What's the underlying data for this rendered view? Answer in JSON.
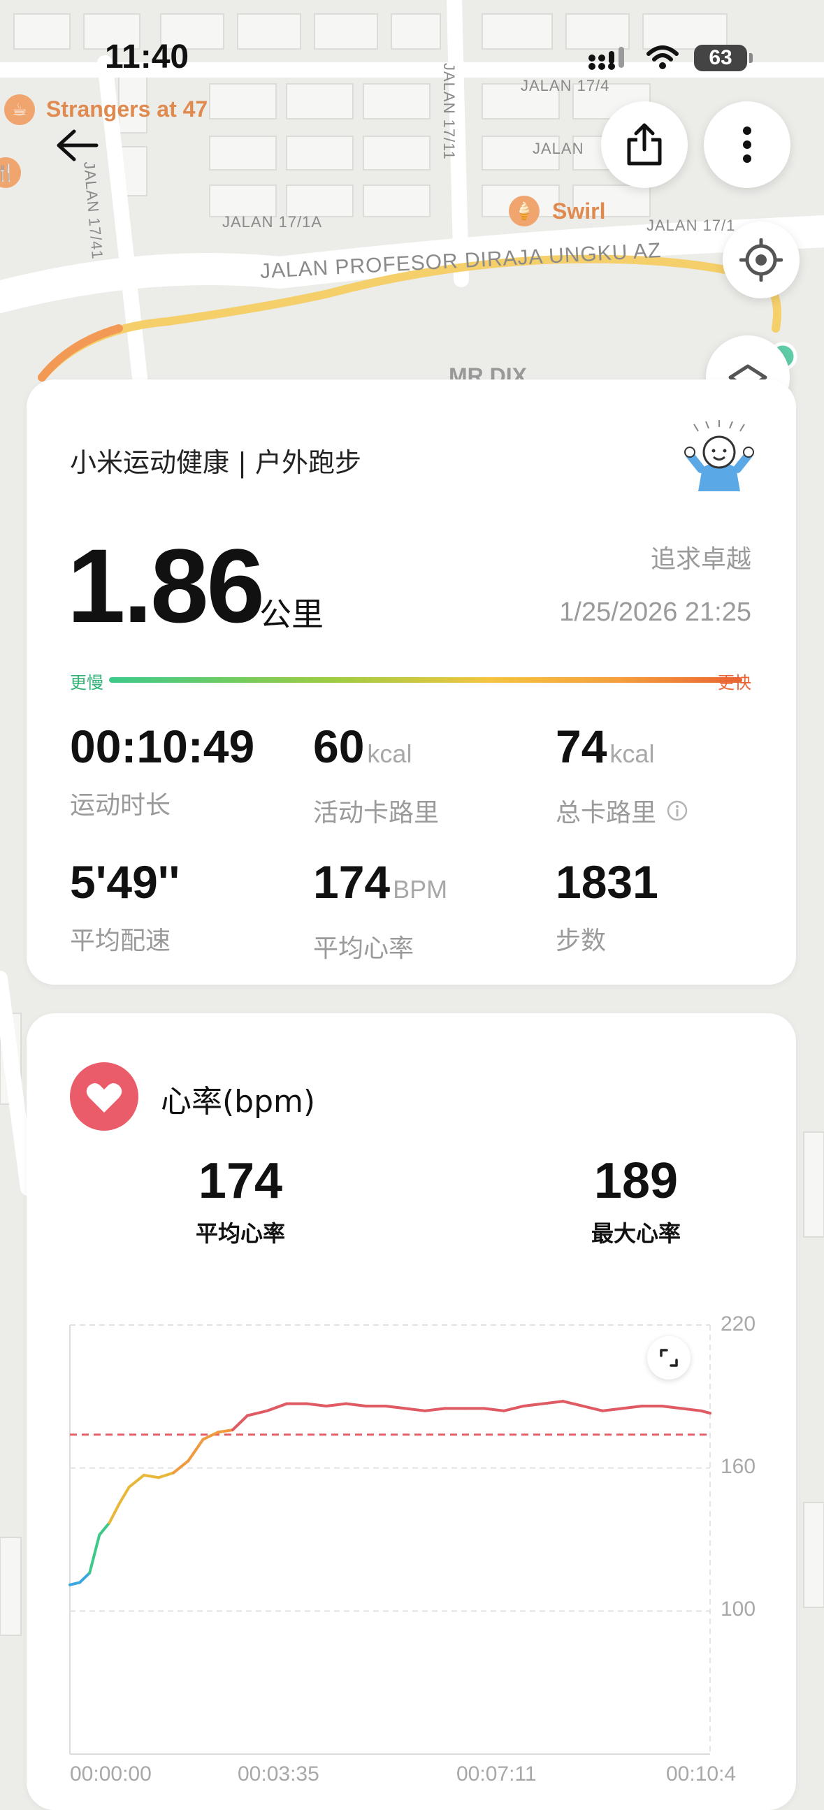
{
  "status_bar": {
    "time": "11:40",
    "battery": "63"
  },
  "map": {
    "streets": [
      "JALAN 17/4",
      "JALAN",
      "JALAN 17/1A",
      "JALAN 17/1",
      "JALAN PROFESOR DIRAJA UNGKU AZ",
      "JALAN 17/11",
      "JALAN 17/41"
    ],
    "pois": [
      "Strangers at 47",
      "Swirl",
      "MR DIX"
    ]
  },
  "summary": {
    "app_title": "小米运动健康 | 户外跑步",
    "distance": "1.86",
    "distance_unit": "公里",
    "motto": "追求卓越",
    "datetime": "1/25/2026 21:25",
    "pace_slow": "更慢",
    "pace_fast": "更快",
    "metrics": [
      {
        "value": "00:10:49",
        "unit": "",
        "label": "运动时长"
      },
      {
        "value": "60",
        "unit": "kcal",
        "label": "活动卡路里"
      },
      {
        "value": "74",
        "unit": "kcal",
        "label": "总卡路里"
      },
      {
        "value": "5'49''",
        "unit": "",
        "label": "平均配速"
      },
      {
        "value": "174",
        "unit": "BPM",
        "label": "平均心率"
      },
      {
        "value": "1831",
        "unit": "",
        "label": "步数"
      }
    ]
  },
  "heart_rate": {
    "title": "心率(bpm)",
    "avg_value": "174",
    "avg_label": "平均心率",
    "max_value": "189",
    "max_label": "最大心率"
  },
  "chart_data": {
    "type": "line",
    "y_ticks": [
      "220",
      "160",
      "100"
    ],
    "x_ticks": [
      "00:00:00",
      "00:03:35",
      "00:07:11",
      "00:10:4"
    ],
    "ylim": [
      40,
      220
    ],
    "xlim": [
      0,
      649
    ],
    "reference_line": 174,
    "series": [
      {
        "x": [
          0,
          10,
          20,
          30,
          40,
          50,
          60,
          75,
          90,
          105,
          120,
          135,
          150,
          165,
          180,
          200,
          220,
          240,
          260,
          280,
          300,
          320,
          340,
          360,
          380,
          400,
          420,
          440,
          460,
          480,
          500,
          520,
          540,
          560,
          580,
          600,
          620,
          640,
          649
        ],
        "values": [
          111,
          112,
          116,
          132,
          137,
          145,
          152,
          157,
          156,
          158,
          163,
          172,
          175,
          176,
          182,
          184,
          187,
          187,
          186,
          187,
          186,
          186,
          185,
          184,
          185,
          185,
          185,
          184,
          186,
          187,
          188,
          186,
          184,
          185,
          186,
          186,
          185,
          184,
          183
        ]
      }
    ],
    "grid": true
  }
}
